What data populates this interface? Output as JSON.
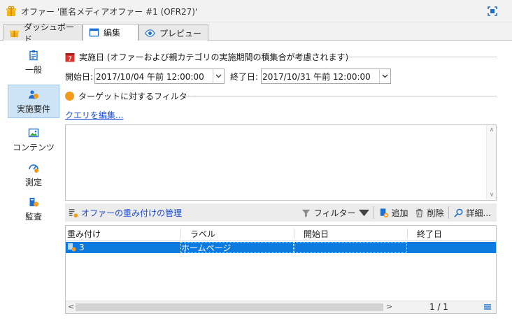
{
  "window": {
    "title": "オファー '匿名メディアオファー #1 (OFR27)'"
  },
  "tabs": [
    {
      "label": "ダッシュボード",
      "icon": "dashboard-icon"
    },
    {
      "label": "編集",
      "icon": "edit-window-icon",
      "active": true
    },
    {
      "label": "プレビュー",
      "icon": "eye-icon"
    }
  ],
  "sidebar": {
    "items": [
      {
        "label": "一般",
        "icon": "clipboard-icon"
      },
      {
        "label": "実施要件",
        "icon": "users-icon",
        "selected": true
      },
      {
        "label": "コンテンツ",
        "icon": "image-icon"
      },
      {
        "label": "測定",
        "icon": "gauge-icon"
      },
      {
        "label": "監査",
        "icon": "audit-icon"
      }
    ]
  },
  "dates_section": {
    "heading": "実施日 (オファーおよび親カテゴリの実施期間の積集合が考慮されます)",
    "start_label": "開始日:",
    "start_value": "2017/10/04 午前 12:00:00",
    "end_label": "終了日:",
    "end_value": "2017/10/31 午前 12:00:00"
  },
  "filter_section": {
    "heading": "ターゲットに対するフィルター",
    "edit_query_link": "クエリを編集..."
  },
  "toolbar": {
    "manage_weights": "オファーの重み付けの管理",
    "filter": "フィルター",
    "add": "追加",
    "delete": "削除",
    "details": "詳細..."
  },
  "grid": {
    "columns": [
      "重み付け",
      "ラベル",
      "開始日",
      "終了日"
    ],
    "rows": [
      {
        "weight": "3",
        "label": "ホームページ",
        "start": "",
        "end": ""
      }
    ],
    "pager": "1 / 1"
  },
  "colors": {
    "selection": "#0d7ae0",
    "sidebar_selected": "#cde4f7",
    "link": "#1a4bd6"
  }
}
